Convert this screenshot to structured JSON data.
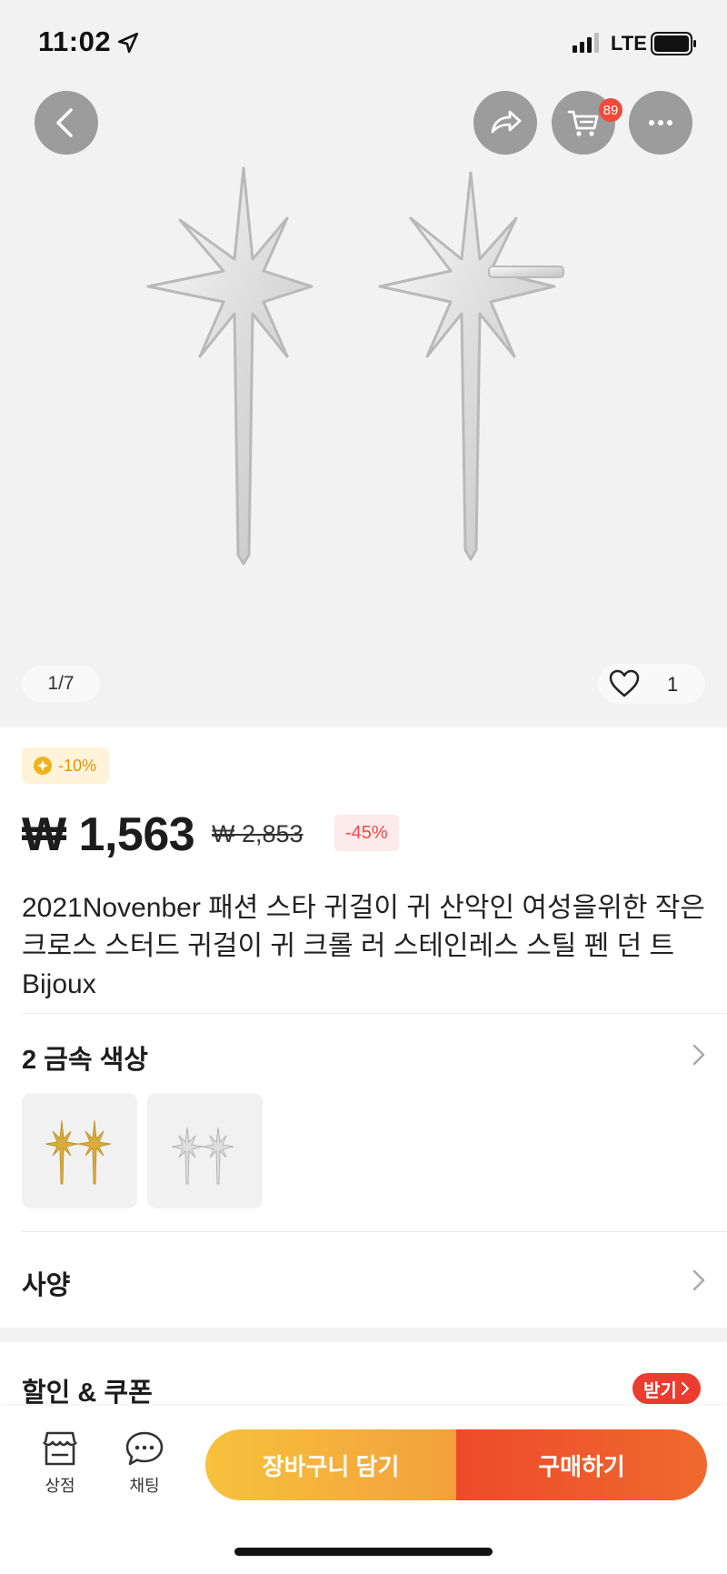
{
  "status_bar": {
    "time": "11:02",
    "network": "LTE",
    "icons": [
      "location-arrow-icon",
      "signal-icon",
      "battery-icon"
    ]
  },
  "header": {
    "cart_badge": "89",
    "icons": [
      "back-icon",
      "share-icon",
      "cart-icon",
      "more-icon"
    ]
  },
  "gallery": {
    "counter": "1/7",
    "favorites_count": "1"
  },
  "pricing": {
    "coupon_tag": "-10%",
    "price": "₩ 1,563",
    "old_price": "₩ 2,853",
    "discount": "-45%"
  },
  "product": {
    "title": "2021Novenber 패션 스타 귀걸이 귀 산악인 여성을위한 작은 크로스 스터드 귀걸이 귀 크롤 러 스테인레스 스틸 펜 던 트 Bijoux"
  },
  "variants": {
    "title": "2 금속 색상",
    "options": [
      {
        "name": "gold",
        "color": "#d9ad3c"
      },
      {
        "name": "silver",
        "color": "#c8c8c8"
      }
    ]
  },
  "specs": {
    "title": "사양"
  },
  "coupons": {
    "title": "할인 & 쿠폰",
    "get_label": "받기"
  },
  "bottom_bar": {
    "store_label": "상점",
    "chat_label": "채팅",
    "add_to_cart": "장바구니 담기",
    "buy_now": "구매하기"
  },
  "colors": {
    "accent_red": "#ec3b2f",
    "cart_gradient_start": "#f7c23c",
    "buy_gradient_start": "#ee4a2a",
    "discount_red": "#ef4a48",
    "coupon_orange": "#e8920a"
  }
}
